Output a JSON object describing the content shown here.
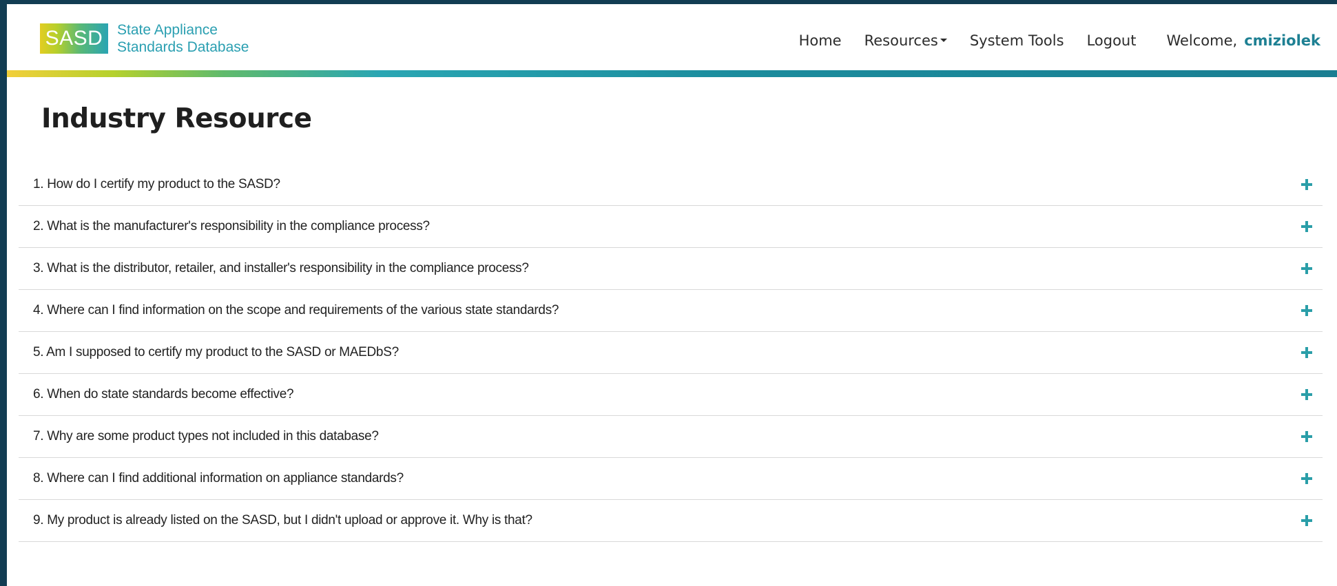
{
  "logo": {
    "mark": "SASD",
    "line1": "State Appliance",
    "line2": "Standards Database"
  },
  "nav": {
    "home": "Home",
    "resources": "Resources",
    "system_tools": "System Tools",
    "logout": "Logout",
    "welcome": "Welcome,",
    "username": "cmiziolek"
  },
  "page": {
    "title": "Industry Resource"
  },
  "faq": [
    {
      "question": "1. How do I certify my product to the SASD?"
    },
    {
      "question": "2. What is the manufacturer's responsibility in the compliance process?"
    },
    {
      "question": "3. What is the distributor, retailer, and installer's responsibility in the compliance process?"
    },
    {
      "question": "4. Where can I find information on the scope and requirements of the various state standards?"
    },
    {
      "question": "5. Am I supposed to certify my product to the SASD or MAEDbS?"
    },
    {
      "question": "6. When do state standards become effective?"
    },
    {
      "question": "7. Why are some product types not included in this database?"
    },
    {
      "question": "8. Where can I find additional information on appliance standards?"
    },
    {
      "question": "9. My product is already listed on the SASD, but I didn't upload or approve it. Why is that?"
    }
  ],
  "icons": {
    "expand": "plus-icon",
    "dropdown": "caret-down-icon"
  },
  "colors": {
    "accent": "#2a9ea8",
    "username": "#1e8093",
    "outer_frame": "#123d53"
  }
}
